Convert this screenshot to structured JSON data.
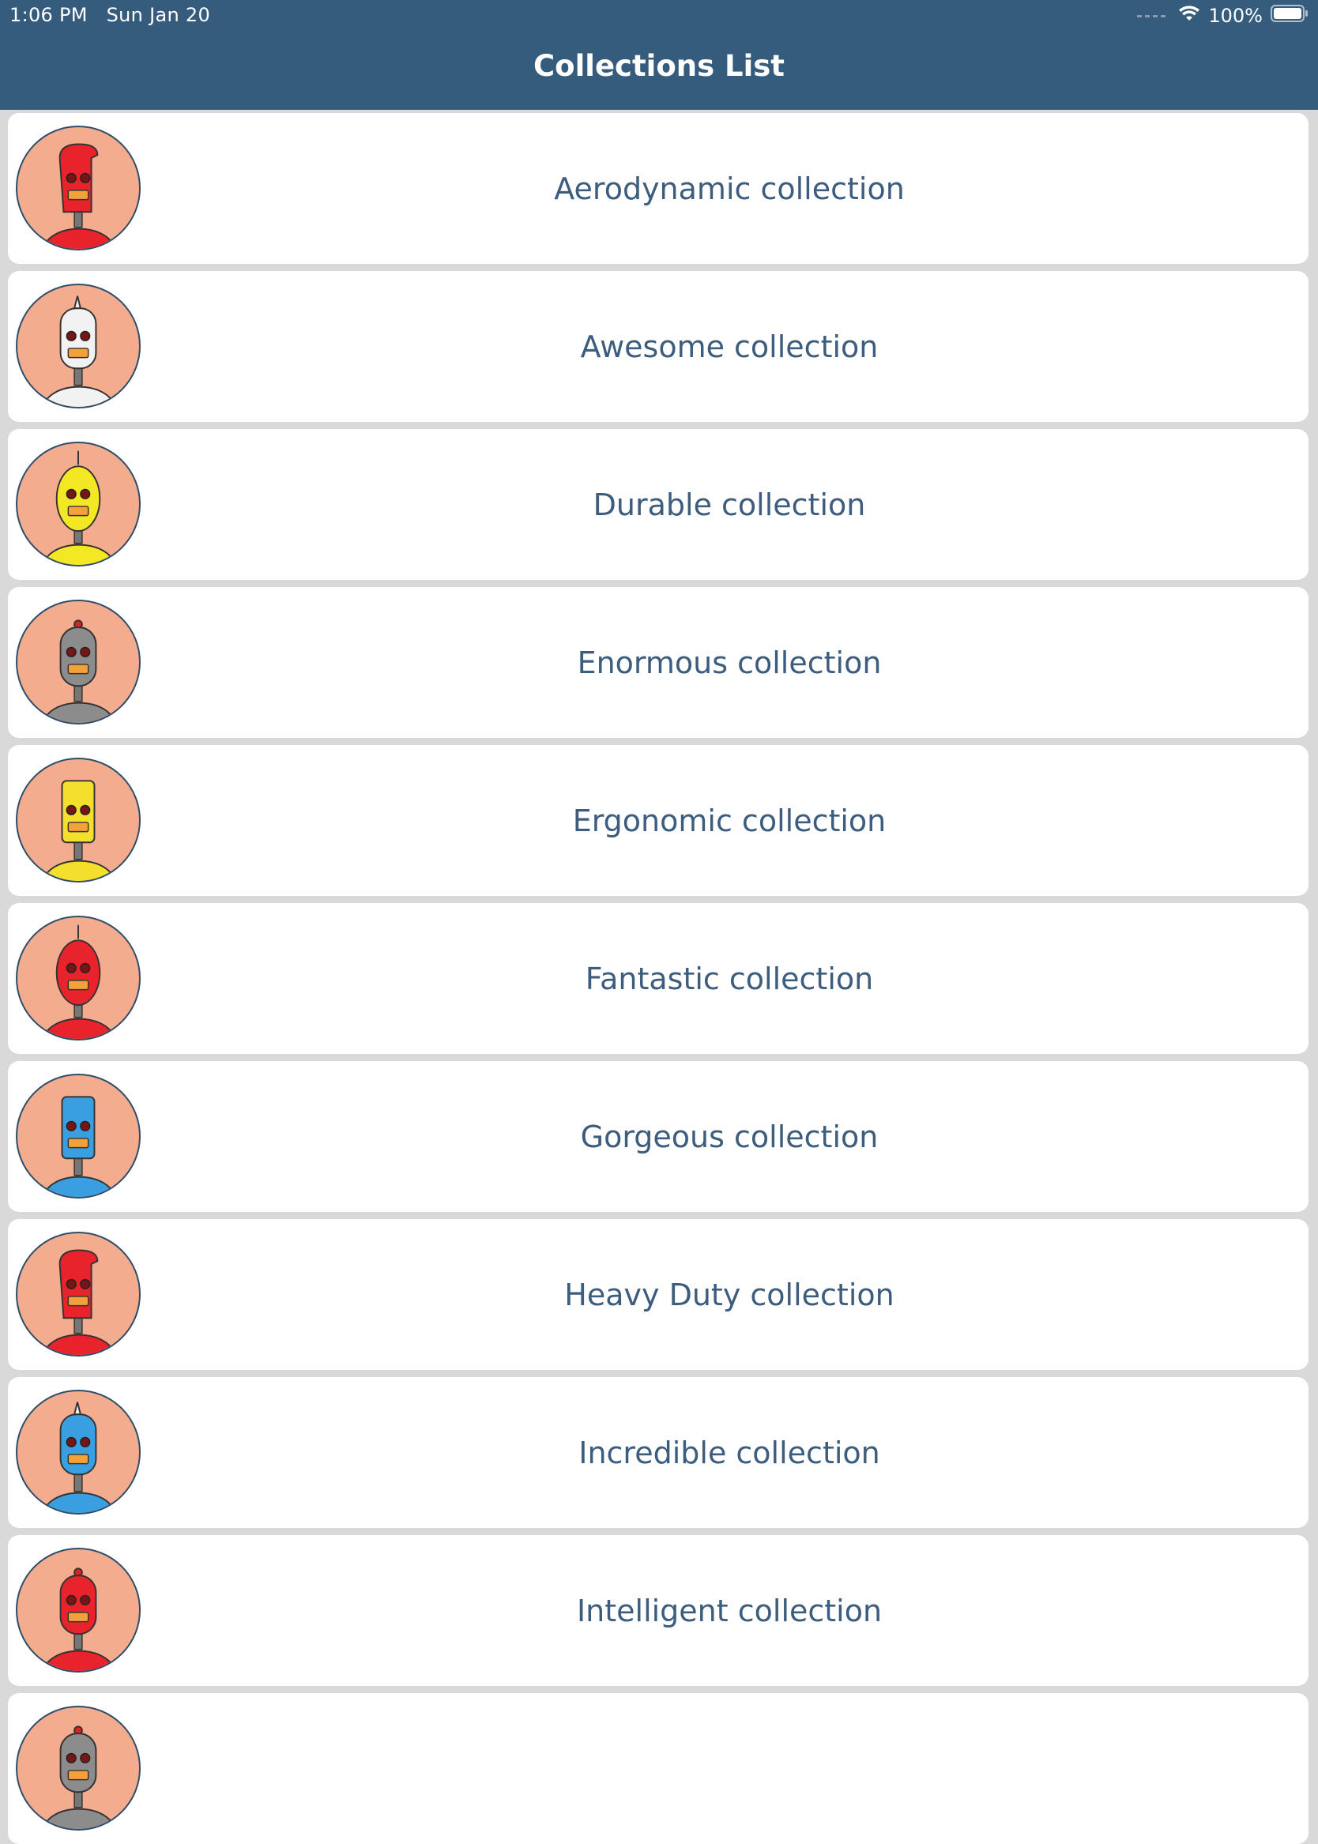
{
  "status_bar": {
    "time": "1:06 PM",
    "date": "Sun Jan 20",
    "battery": "100%"
  },
  "nav": {
    "title": "Collections List"
  },
  "items": [
    {
      "label": "Aerodynamic collection",
      "icon": "robot-avatar-red-icon",
      "color": "#e8232b",
      "head": "curve"
    },
    {
      "label": "Awesome collection",
      "icon": "robot-avatar-white-icon",
      "color": "#f2f2f2",
      "head": "bullet"
    },
    {
      "label": "Durable collection",
      "icon": "robot-avatar-yellow-icon",
      "color": "#f4e824",
      "head": "egg"
    },
    {
      "label": "Enormous collection",
      "icon": "robot-avatar-gray-icon",
      "color": "#8c8c8c",
      "head": "dome"
    },
    {
      "label": "Ergonomic collection",
      "icon": "robot-avatar-yellow-icon",
      "color": "#f4e02c",
      "head": "box"
    },
    {
      "label": "Fantastic collection",
      "icon": "robot-avatar-red-icon",
      "color": "#e8232b",
      "head": "egg"
    },
    {
      "label": "Gorgeous collection",
      "icon": "robot-avatar-blue-icon",
      "color": "#3a9fe0",
      "head": "box"
    },
    {
      "label": "Heavy Duty collection",
      "icon": "robot-avatar-red-icon",
      "color": "#e8232b",
      "head": "curve"
    },
    {
      "label": "Incredible collection",
      "icon": "robot-avatar-blue-icon",
      "color": "#3a9fe0",
      "head": "bullet"
    },
    {
      "label": "Intelligent collection",
      "icon": "robot-avatar-red-icon",
      "color": "#e8232b",
      "head": "dome"
    },
    {
      "label": "",
      "icon": "robot-avatar-gray-icon",
      "color": "#8c8c8c",
      "head": "dome"
    }
  ]
}
